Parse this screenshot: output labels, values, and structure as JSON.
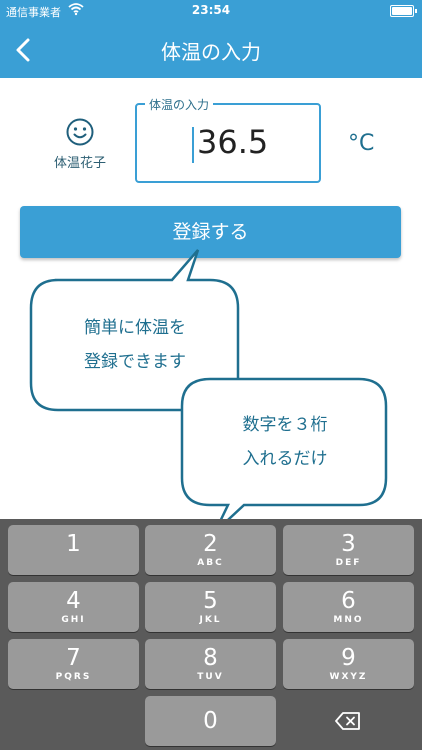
{
  "status_bar": {
    "carrier": "通信事業者",
    "time": "23:54",
    "battery_level": 1.0
  },
  "nav": {
    "title": "体温の入力",
    "back_icon": "chevron-left-icon"
  },
  "profile": {
    "icon": "smiley-face-icon",
    "name": "体温花子"
  },
  "temperature": {
    "legend": "体温の入力",
    "value": "36.5",
    "unit": "°C"
  },
  "actions": {
    "register_label": "登録する"
  },
  "callouts": {
    "first": [
      "簡単に体温を",
      "登録できます"
    ],
    "second": [
      "数字を３桁",
      "入れるだけ"
    ]
  },
  "keypad": {
    "keys": [
      {
        "num": "1",
        "letters": ""
      },
      {
        "num": "2",
        "letters": "ABC"
      },
      {
        "num": "3",
        "letters": "DEF"
      },
      {
        "num": "4",
        "letters": "GHI"
      },
      {
        "num": "5",
        "letters": "JKL"
      },
      {
        "num": "6",
        "letters": "MNO"
      },
      {
        "num": "7",
        "letters": "PQRS"
      },
      {
        "num": "8",
        "letters": "TUV"
      },
      {
        "num": "9",
        "letters": "WXYZ"
      },
      {
        "num": "0",
        "letters": ""
      }
    ],
    "delete_icon": "backspace-icon"
  },
  "colors": {
    "accent": "#3a9fd5",
    "text_dark": "#1f6f8f",
    "keyboard_bg": "#5a5a5a",
    "key_bg": "#9a9a9a"
  }
}
